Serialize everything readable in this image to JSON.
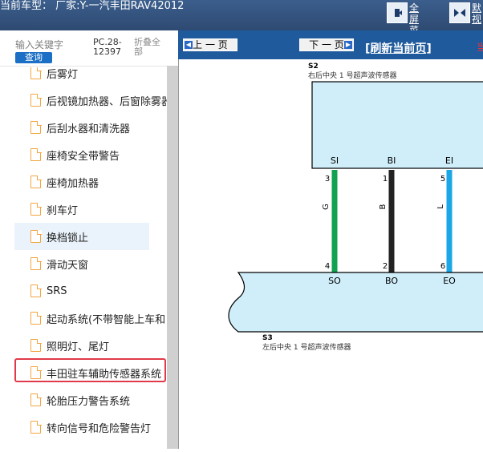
{
  "topbar": {
    "title": "当前车型：  厂家:Y-一汽丰田RAV42012",
    "fullscreen_menu_label": "全屏\n菜单",
    "default_view_label": "默\n视"
  },
  "left": {
    "search_placeholder": "输入关键字",
    "query_button": "查询",
    "code": "PC.28-12397",
    "collapse_all": "折叠全部",
    "items": [
      "后雾灯",
      "后视镜加热器、后窗除雾器",
      "后刮水器和清洗器",
      "座椅安全带警告",
      "座椅加热器",
      "刹车灯",
      "换档锁止",
      "滑动天窗",
      "SRS",
      "起动系统(不带智能上车和",
      "照明灯、尾灯",
      "丰田驻车辅助传感器系统",
      "轮胎压力警告系统",
      "转向信号和危险警告灯"
    ]
  },
  "right": {
    "prev_page": "上 一 页",
    "next_page": "下 一 页",
    "refresh": "[刷新当前页]",
    "corner_text": "当"
  },
  "diagram": {
    "s2_id": "S2",
    "s2_name": "右后中央 1 号超声波传感器",
    "s3_id": "S3",
    "s3_name": "左后中央 1 号超声波传感器",
    "top_pins": [
      "SI",
      "BI",
      "EI"
    ],
    "bottom_pins": [
      "SO",
      "BO",
      "EO"
    ],
    "top_nums": [
      "3",
      "1",
      "5"
    ],
    "bottom_nums": [
      "4",
      "2",
      "6"
    ],
    "wire_colors_text": [
      "G",
      "B",
      "L"
    ],
    "wire_colors_hex": [
      "#12a150",
      "#222222",
      "#1ba6e6"
    ],
    "box_fill": "#cfeefa"
  }
}
